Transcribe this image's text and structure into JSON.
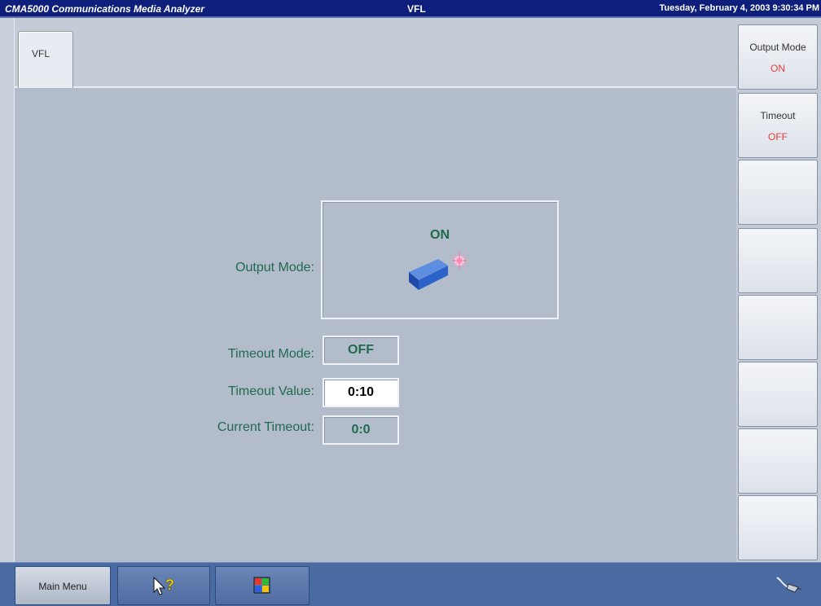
{
  "titlebar": {
    "app_title": "CMA5000 Communications Media Analyzer",
    "screen_title": "VFL",
    "datetime": "Tuesday, February 4, 2003 9:30:34 PM"
  },
  "tabs": [
    {
      "label": "VFL",
      "active": true
    }
  ],
  "softkeys": [
    {
      "label": "Output Mode",
      "value": "ON"
    },
    {
      "label": "Timeout",
      "value": "OFF"
    },
    {
      "label": "",
      "value": ""
    },
    {
      "label": "",
      "value": ""
    },
    {
      "label": "",
      "value": ""
    },
    {
      "label": "",
      "value": ""
    },
    {
      "label": "",
      "value": ""
    },
    {
      "label": "",
      "value": ""
    }
  ],
  "main": {
    "output_mode": {
      "label": "Output Mode:",
      "value": "ON",
      "icon": "laser-on-icon"
    },
    "timeout_mode": {
      "label": "Timeout Mode:",
      "value": "OFF"
    },
    "timeout_value": {
      "label": "Timeout Value:",
      "value": "0:10"
    },
    "current_timeout": {
      "label": "Current Timeout:",
      "value": "0:0"
    }
  },
  "bottombar": {
    "main_menu_label": "Main Menu",
    "help_icon": "pointer-help-icon",
    "windows_icon": "windows-flag-icon",
    "status_icon": "cable-plug-icon"
  },
  "colors": {
    "titlebar_bg": "#0d1f7a",
    "main_bg": "#b2bccb",
    "label_green": "#206b50",
    "softkey_value_red": "#e44040",
    "bottombar_bg": "#4a6aa2"
  }
}
